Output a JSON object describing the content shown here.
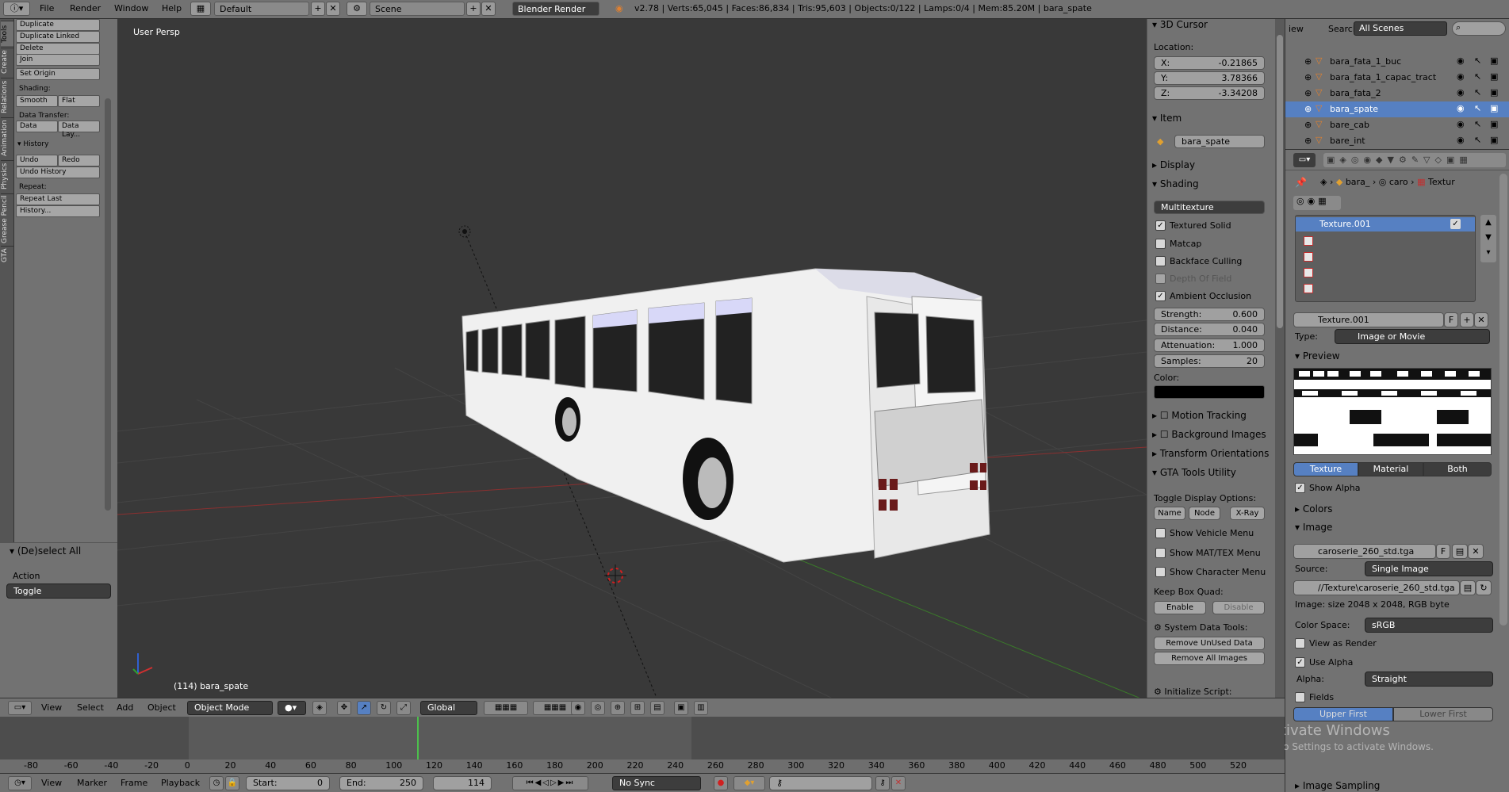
{
  "topbar": {
    "menus": [
      "File",
      "Render",
      "Window",
      "Help"
    ],
    "screen_layout": "Default",
    "scene": "Scene",
    "engine": "Blender Render",
    "stats": "v2.78 | Verts:65,045 | Faces:86,834 | Tris:95,603 | Objects:0/122 | Lamps:0/4 | Mem:85.20M | bara_spate"
  },
  "left_tabs": [
    "Tools",
    "Create",
    "Relations",
    "Animation",
    "Physics",
    "Grease Pencil",
    "GTA"
  ],
  "toolshelf": {
    "duplicate": "Duplicate",
    "duplicate_linked": "Duplicate Linked",
    "delete": "Delete",
    "join": "Join",
    "set_origin": "Set Origin",
    "shading_label": "Shading:",
    "smooth": "Smooth",
    "flat": "Flat",
    "data_transfer_label": "Data Transfer:",
    "data": "Data",
    "data_lay": "Data Lay...",
    "history_head": "History",
    "undo": "Undo",
    "redo": "Redo",
    "undo_history": "Undo History",
    "repeat_label": "Repeat:",
    "repeat_last": "Repeat Last",
    "history_btn": "History..."
  },
  "operator_panel": {
    "title": "(De)select All",
    "action_label": "Action",
    "action_value": "Toggle"
  },
  "viewport": {
    "view_label": "User Persp",
    "object_label": "(114) bara_spate"
  },
  "npanel": {
    "cursor_head": "3D Cursor",
    "location_label": "Location:",
    "x_label": "X:",
    "x_value": "-0.21865",
    "y_label": "Y:",
    "y_value": "3.78366",
    "z_label": "Z:",
    "z_value": "-3.34208",
    "item_head": "Item",
    "item_name": "bara_spate",
    "display_head": "Display",
    "shading_head": "Shading",
    "shading_mode": "Multitexture",
    "textured_solid": "Textured Solid",
    "matcap": "Matcap",
    "backface": "Backface Culling",
    "dof": "Depth Of Field",
    "ao": "Ambient Occlusion",
    "strength_label": "Strength:",
    "strength_value": "0.600",
    "distance_label": "Distance:",
    "distance_value": "0.040",
    "attenuation_label": "Attenuation:",
    "attenuation_value": "1.000",
    "samples_label": "Samples:",
    "samples_value": "20",
    "color_label": "Color:",
    "motion_tracking": "Motion Tracking",
    "background_images": "Background Images",
    "transform_orientations": "Transform Orientations",
    "gta_head": "GTA Tools Utility",
    "toggle_display": "Toggle Display Options:",
    "name_btn": "Name",
    "node_btn": "Node",
    "xray_btn": "X-Ray",
    "show_vehicle": "Show Vehicle Menu",
    "show_mattex": "Show MAT/TEX Menu",
    "show_character": "Show Character Menu",
    "keep_box": "Keep Box Quad:",
    "enable": "Enable",
    "disable": "Disable",
    "system_tools": "System Data Tools:",
    "remove_unused": "Remove UnUsed Data",
    "remove_images": "Remove All Images",
    "initialize": "Initialize Script:"
  },
  "outliner": {
    "tab_view": "iew",
    "search": "Search",
    "scenes": "All Scenes",
    "items": [
      "bara_fata_1_buc",
      "bara_fata_1_capac_tract",
      "bara_fata_2",
      "bara_spate",
      "bare_cab",
      "bare_int"
    ]
  },
  "props": {
    "breadcrumb": [
      "bara_",
      "caro",
      "Textur"
    ],
    "texture_slot": "Texture.001",
    "texture_name": "Texture.001",
    "texture_f": "F",
    "type_label": "Type:",
    "type_value": "Image or Movie",
    "preview_head": "Preview",
    "tab_texture": "Texture",
    "tab_material": "Material",
    "tab_both": "Both",
    "show_alpha": "Show Alpha",
    "colors_head": "Colors",
    "image_head": "Image",
    "image_name": "caroserie_260_std.tga",
    "image_f": "F",
    "source_label": "Source:",
    "source_value": "Single Image",
    "filepath": "//Texture\\caroserie_260_std.tga",
    "image_info": "Image: size 2048 x 2048, RGB byte",
    "colorspace_label": "Color Space:",
    "colorspace_value": "sRGB",
    "view_as_render": "View as Render",
    "use_alpha": "Use Alpha",
    "alpha_label": "Alpha:",
    "alpha_value": "Straight",
    "fields": "Fields",
    "upper_first": "Upper First",
    "lower_first": "Lower First",
    "image_sampling": "Image Sampling",
    "watermark_1": "Activate Windows",
    "watermark_2": "Go to Settings to activate Windows."
  },
  "view_header": {
    "menus": [
      "View",
      "Select",
      "Add",
      "Object"
    ],
    "mode": "Object Mode",
    "orientation": "Global"
  },
  "timeline": {
    "ticks": [
      "-80",
      "-60",
      "-40",
      "-20",
      "0",
      "20",
      "40",
      "60",
      "80",
      "100",
      "120",
      "140",
      "160",
      "180",
      "200",
      "220",
      "240",
      "260",
      "280",
      "300",
      "320",
      "340",
      "360",
      "380",
      "400",
      "420",
      "440",
      "460",
      "480",
      "500",
      "520"
    ],
    "menus": [
      "View",
      "Marker",
      "Frame",
      "Playback"
    ],
    "start_label": "Start:",
    "start_value": "0",
    "end_label": "End:",
    "end_value": "250",
    "current": "114",
    "sync": "No Sync"
  },
  "colors": {
    "panel": "#727272",
    "viewport": "#393939",
    "selection": "#5680c2",
    "x_axis": "#b03a3a",
    "y_axis": "#4a9a3a"
  }
}
